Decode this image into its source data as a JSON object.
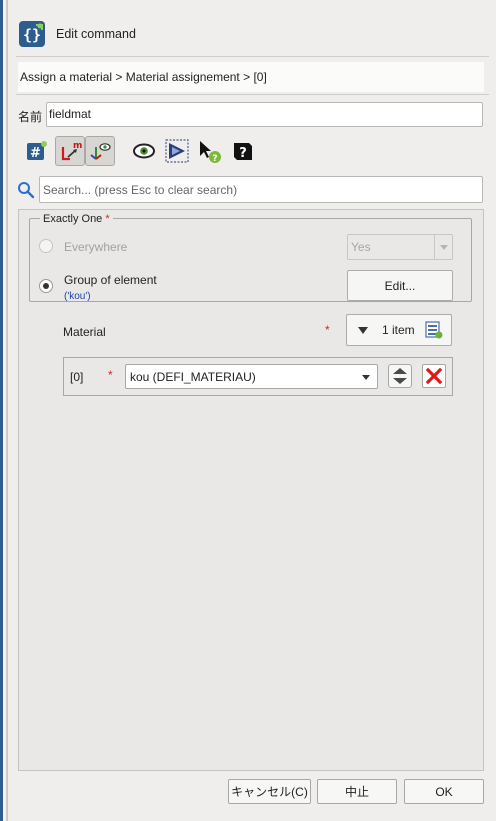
{
  "window": {
    "title": "Edit command",
    "breadcrumb": "Assign a material > Material assignement > [0]"
  },
  "name_row": {
    "label": "名前",
    "value": "fieldmat"
  },
  "toolbar": {
    "icons": [
      "hash-icon",
      "local-frame-icon",
      "axis-view-icon",
      "eye-icon",
      "filter-run-icon",
      "pointer-help-icon",
      "doc-help-icon"
    ]
  },
  "search": {
    "placeholder": "Search... (press Esc to clear search)"
  },
  "exactly_one": {
    "title": "Exactly One",
    "required_mark": "*",
    "everywhere_label": "Everywhere",
    "everywhere_value": "Yes",
    "group_label": "Group of element",
    "group_sub": "('kou')",
    "edit_label": "Edit..."
  },
  "material": {
    "label": "Material",
    "required_mark": "*",
    "count_label": "1 item",
    "items": [
      {
        "index": "[0]",
        "required_mark": "*",
        "value": "kou (DEFI_MATERIAU)"
      }
    ]
  },
  "buttons": {
    "cancel": "キャンセル(C)",
    "abort": "中止",
    "ok": "OK"
  },
  "colors": {
    "accent_blue": "#2f5f8f",
    "required_red": "#e02020",
    "delete_red": "#e01818",
    "link_blue": "#1f3fa4"
  }
}
